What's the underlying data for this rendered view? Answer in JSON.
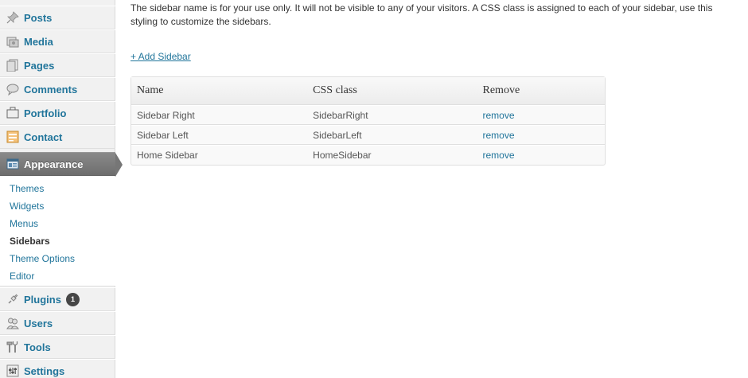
{
  "sidebar": {
    "menu": [
      {
        "label": "Posts",
        "icon": "pushpin-icon"
      },
      {
        "label": "Media",
        "icon": "media-icon"
      },
      {
        "label": "Pages",
        "icon": "pages-icon"
      },
      {
        "label": "Comments",
        "icon": "comment-icon"
      },
      {
        "label": "Portfolio",
        "icon": "portfolio-icon"
      },
      {
        "label": "Contact",
        "icon": "contact-icon"
      },
      {
        "label": "Appearance",
        "icon": "appearance-icon"
      },
      {
        "label": "Plugins",
        "icon": "plugin-icon",
        "badge": "1"
      },
      {
        "label": "Users",
        "icon": "users-icon"
      },
      {
        "label": "Tools",
        "icon": "tools-icon"
      },
      {
        "label": "Settings",
        "icon": "settings-icon"
      }
    ],
    "submenu": [
      {
        "label": "Themes"
      },
      {
        "label": "Widgets"
      },
      {
        "label": "Menus"
      },
      {
        "label": "Sidebars",
        "current": true
      },
      {
        "label": "Theme Options"
      },
      {
        "label": "Editor"
      }
    ]
  },
  "main": {
    "description": "The sidebar name is for your use only. It will not be visible to any of your visitors. A CSS class is assigned to each of your sidebar, use this styling to customize the sidebars.",
    "add_sidebar_label": "+ Add Sidebar",
    "table": {
      "headers": [
        "Name",
        "CSS class",
        "Remove"
      ],
      "rows": [
        {
          "name": "Sidebar Right",
          "css_class": "SidebarRight",
          "remove": "remove"
        },
        {
          "name": "Sidebar Left",
          "css_class": "SidebarLeft",
          "remove": "remove"
        },
        {
          "name": "Home Sidebar",
          "css_class": "HomeSidebar",
          "remove": "remove"
        }
      ]
    }
  },
  "colors": {
    "link": "#21759b",
    "sidebar_bg": "#f1f1f1",
    "active_menu": "#777777"
  }
}
